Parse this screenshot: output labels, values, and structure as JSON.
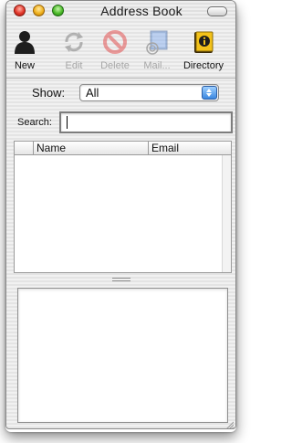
{
  "window": {
    "title": "Address Book"
  },
  "toolbar": {
    "items": [
      {
        "label": "New",
        "icon": "person-silhouette-icon",
        "enabled": true
      },
      {
        "label": "Edit",
        "icon": "edit-arrows-icon",
        "enabled": false
      },
      {
        "label": "Delete",
        "icon": "delete-circle-icon",
        "enabled": false
      },
      {
        "label": "Mail...",
        "icon": "mail-stamp-icon",
        "enabled": false
      },
      {
        "label": "Directory",
        "icon": "directory-book-icon",
        "enabled": true
      }
    ]
  },
  "filter": {
    "show_label": "Show:",
    "show_value": "All"
  },
  "search": {
    "label": "Search:",
    "value": ""
  },
  "list": {
    "columns": [
      "Name",
      "Email"
    ],
    "rows": []
  },
  "colors": {
    "accent_blue": "#3a87e0",
    "disabled_text": "#a7a7a7"
  }
}
